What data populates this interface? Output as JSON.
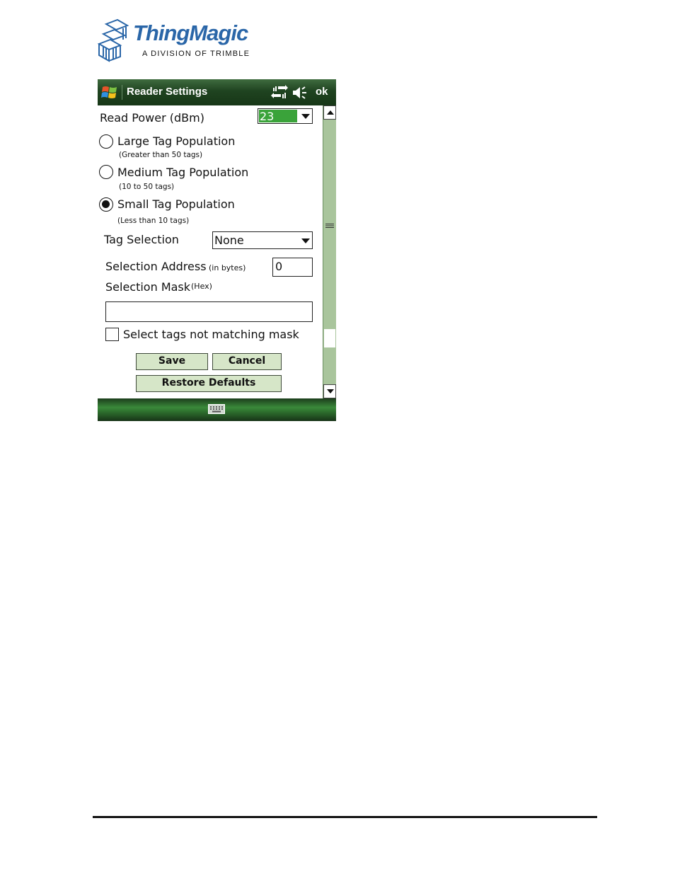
{
  "logo": {
    "name": "ThingMagic",
    "subtitle": "A DIVISION OF TRIMBLE"
  },
  "titlebar": {
    "title": "Reader Settings",
    "ok_label": "ok",
    "icons": [
      "windows-start-icon",
      "connectivity-icon",
      "speaker-icon"
    ]
  },
  "form": {
    "read_power_label": "Read Power (dBm)",
    "read_power_value": "23",
    "populations": [
      {
        "label": "Large Tag Population",
        "note": "(Greater than 50 tags)",
        "selected": false
      },
      {
        "label": "Medium Tag Population",
        "note": "(10 to 50 tags)",
        "selected": false
      },
      {
        "label": "Small Tag Population",
        "note": "(Less than 10 tags)",
        "selected": true
      }
    ],
    "tag_selection_label": "Tag Selection",
    "tag_selection_value": "None",
    "selection_address_label": "Selection Address",
    "selection_address_unit": "(in bytes)",
    "selection_address_value": "0",
    "selection_mask_label": "Selection Mask",
    "selection_mask_unit": "(Hex)",
    "selection_mask_value": "",
    "not_matching_label": "Select tags not matching mask",
    "not_matching_checked": false
  },
  "buttons": {
    "save": "Save",
    "cancel": "Cancel",
    "restore": "Restore Defaults"
  },
  "colors": {
    "titlebar": "#1f4320",
    "button_fill": "#d6e6c8",
    "read_power_highlight": "#3aa33a",
    "logo_blue": "#2a66a8"
  }
}
